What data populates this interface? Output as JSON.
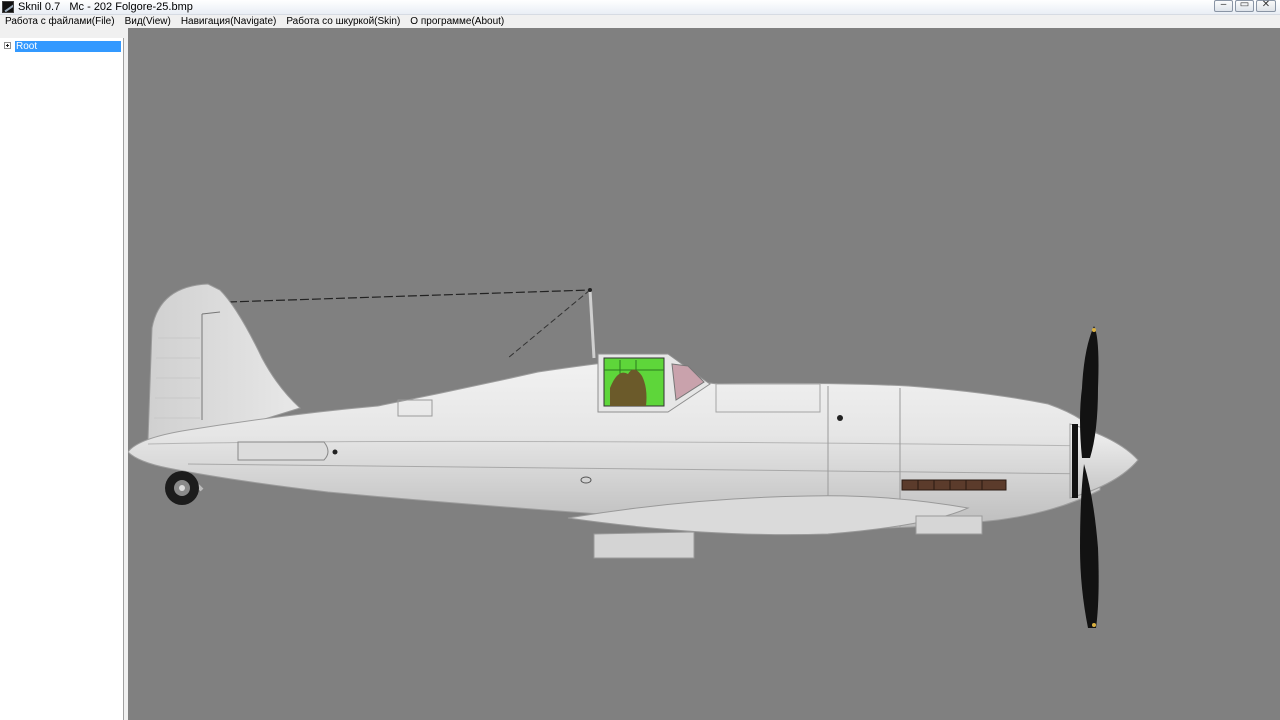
{
  "window": {
    "app_name": "Sknil 0.7",
    "file_name": "Mc - 202 Folgore-25.bmp"
  },
  "title_buttons": {
    "minimize_glyph": "–",
    "maximize_glyph": "▭",
    "close_glyph": "✕"
  },
  "menu": {
    "items": [
      {
        "label": "Работа с файлами(File)"
      },
      {
        "label": "Вид(View)"
      },
      {
        "label": "Навигация(Navigate)"
      },
      {
        "label": "Работа со шкуркой(Skin)"
      },
      {
        "label": "О программе(About)"
      }
    ]
  },
  "tree": {
    "root_label": "Root",
    "expander_icon": "plus-box-icon"
  },
  "viewport": {
    "background": "#808080",
    "model_color": "#e4e4e4",
    "canopy_color": "#5ed63a",
    "propeller_color": "#111111"
  },
  "colors": {
    "selection": "#3399ff"
  }
}
